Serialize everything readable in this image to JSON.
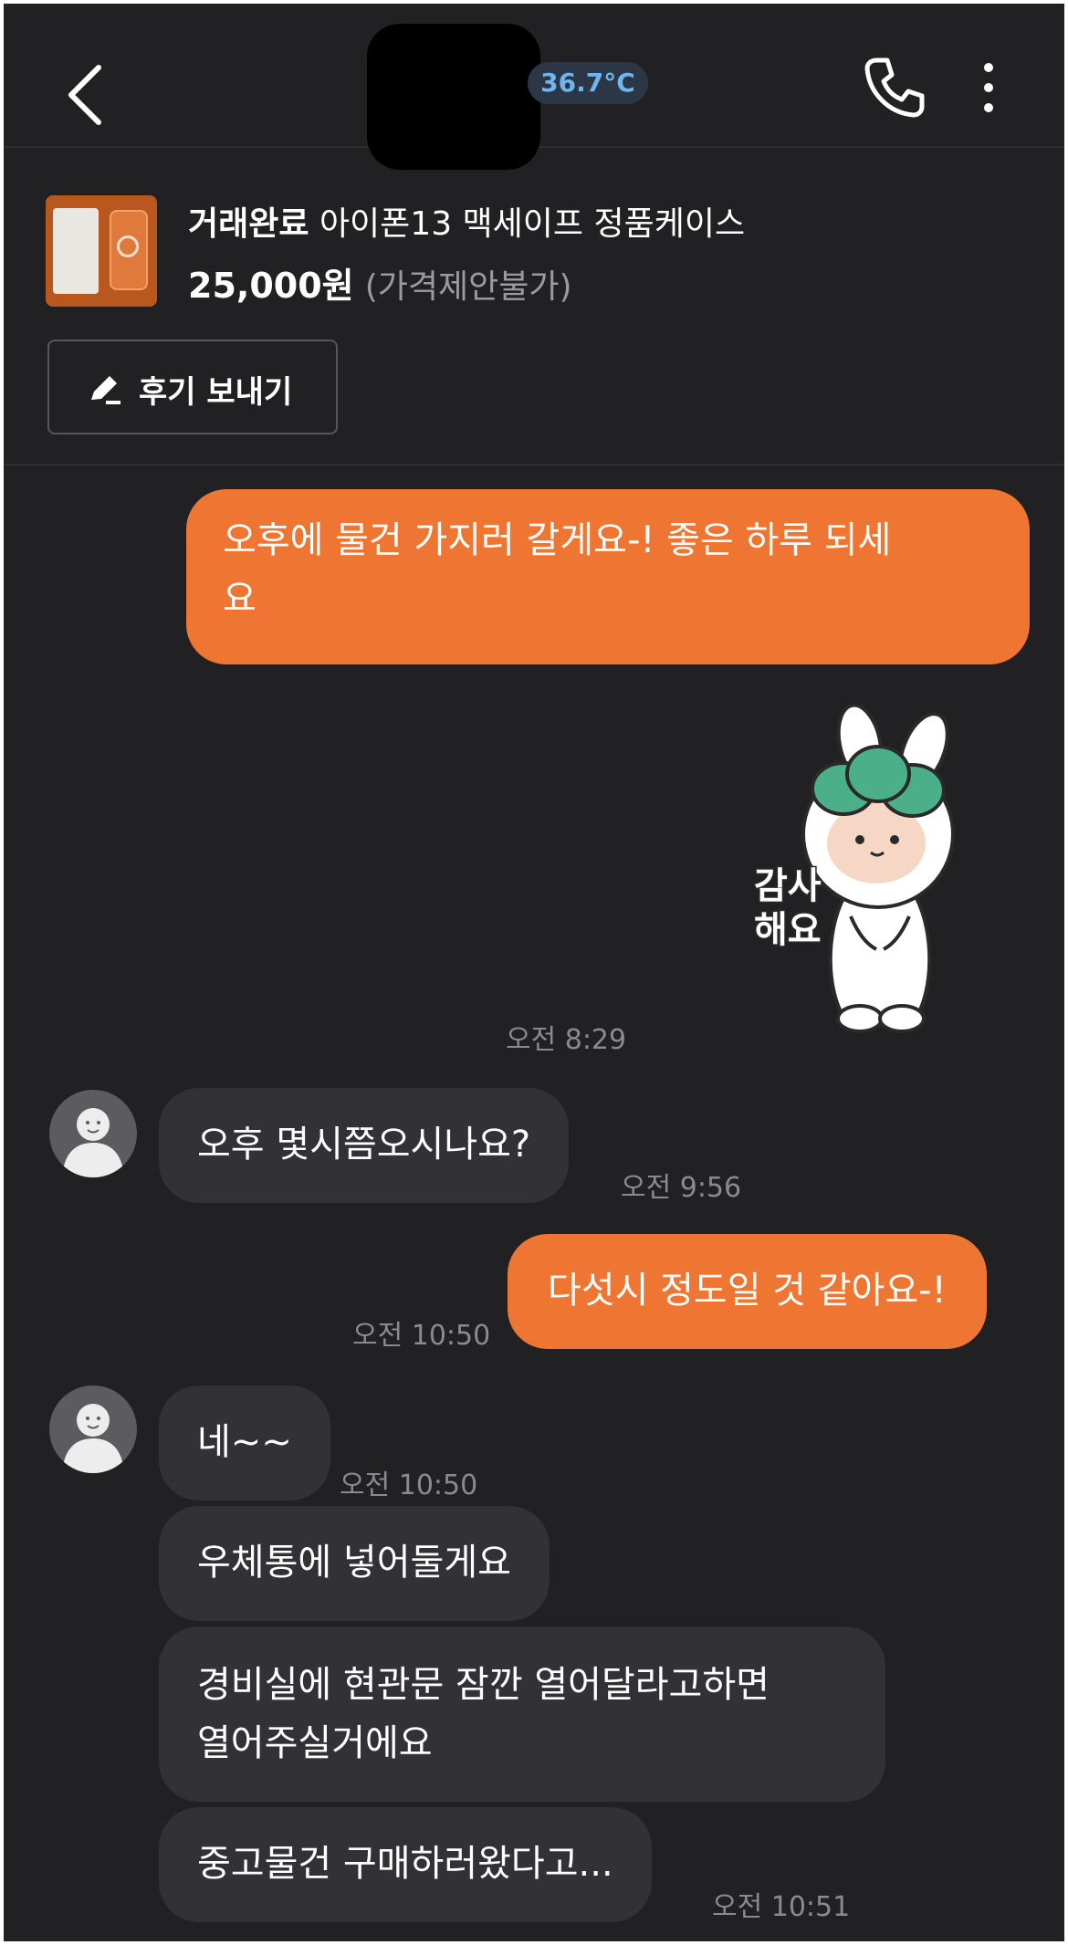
{
  "header": {
    "temperature": "36.7°C"
  },
  "product": {
    "status": "거래완료",
    "title": "아이폰13 맥세이프 정품케이스",
    "price": "25,000원",
    "negotiable": "(가격제안불가)",
    "review_button": "후기 보내기"
  },
  "messages": {
    "m1": {
      "line1": "오후에 물건 가지러 갈게요-! 좋은 하루 되세",
      "line2": "요"
    },
    "sticker_text": {
      "line1": "감사",
      "line2": "해요"
    },
    "t1": "오전 8:29",
    "m2": "오후 몇시쯤오시나요?",
    "t2": "오전 9:56",
    "m3": "다섯시 정도일 것 같아요-!",
    "t3": "오전 10:50",
    "m4": "네~~",
    "t4": "오전 10:50",
    "m5": "우체통에 넣어둘게요",
    "m6": {
      "line1": "경비실에 현관문 잠깐 열어달라고하면",
      "line2": "열어주실거에요"
    },
    "m7": "중고물건 구매하러왔다고...",
    "t5": "오전 10:51"
  },
  "colors": {
    "background": "#212124",
    "accent_orange": "#ee7532",
    "incoming_bubble": "#323236",
    "temperature_blue": "#6fb6ef"
  }
}
